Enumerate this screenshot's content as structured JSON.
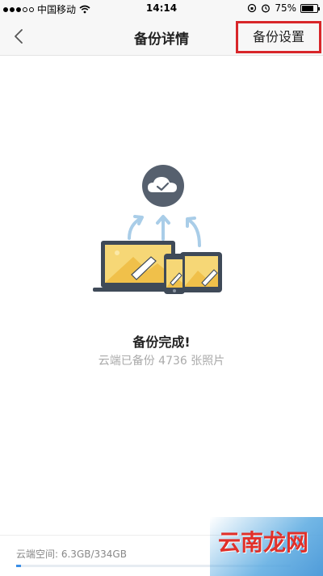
{
  "status_bar": {
    "carrier": "中国移动",
    "time": "14:14",
    "battery": "75%",
    "battery_level": 0.75
  },
  "nav": {
    "title": "备份详情",
    "settings_label": "备份设置"
  },
  "backup": {
    "title": "备份完成!",
    "subtitle": "云端已备份 4736 张照片"
  },
  "storage": {
    "label": "云端空间: 6.3GB/334GB",
    "used_fraction": 0.019
  },
  "watermark": {
    "text": "云南龙网"
  },
  "colors": {
    "highlight_border": "#d8262a",
    "cloud": "#56606e",
    "arrow": "#a9cde8",
    "device_screen": "#f6d776",
    "device_frame": "#3f4a58"
  }
}
